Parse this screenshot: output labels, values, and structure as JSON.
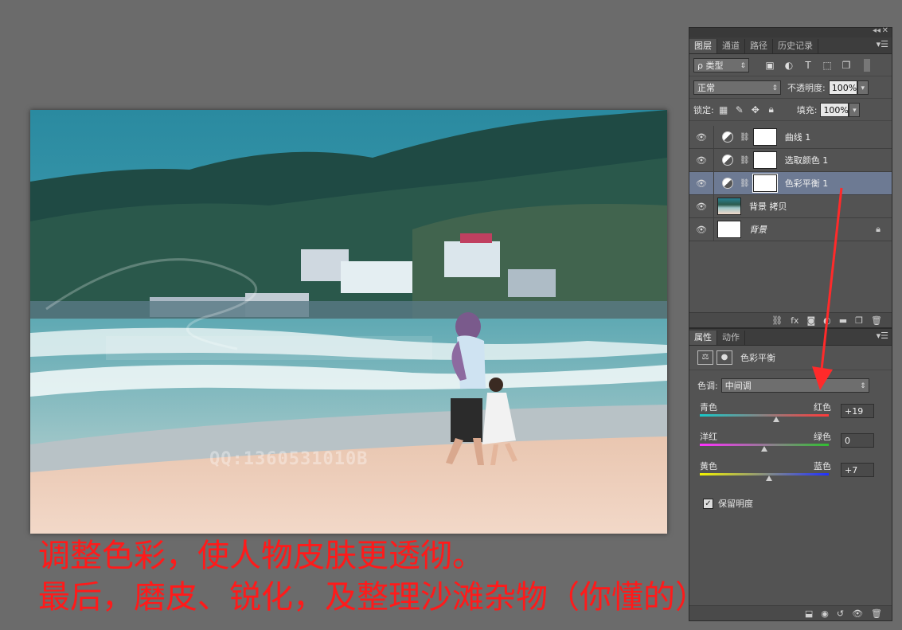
{
  "photo": {
    "watermark": "QQ:1360531010B"
  },
  "caption": {
    "line1": "调整色彩，使人物皮肤更透彻。",
    "line2": "最后，磨皮、锐化，及整理沙滩杂物（你懂的）"
  },
  "layers_panel": {
    "tabs": [
      "图层",
      "通道",
      "路径",
      "历史记录"
    ],
    "active_tab": 0,
    "filter_label": "ρ 类型",
    "blend_mode": "正常",
    "opacity_label": "不透明度:",
    "opacity_value": "100%",
    "lock_label": "锁定:",
    "fill_label": "填充:",
    "fill_value": "100%",
    "layers": [
      {
        "name": "曲线 1",
        "type": "adjustment",
        "selected": false
      },
      {
        "name": "选取颜色 1",
        "type": "adjustment",
        "selected": false
      },
      {
        "name": "色彩平衡 1",
        "type": "adjustment",
        "selected": true
      },
      {
        "name": "背景 拷贝",
        "type": "image",
        "selected": false
      },
      {
        "name": "背景",
        "type": "background",
        "selected": false
      }
    ]
  },
  "props_panel": {
    "tabs": [
      "属性",
      "动作"
    ],
    "title": "色彩平衡",
    "tone_label": "色调:",
    "tone_value": "中间调",
    "sliders": [
      {
        "left": "青色",
        "right": "红色",
        "value": "+19",
        "position": 0.59,
        "gradient": [
          "#18c9c9",
          "#ff3a3a"
        ]
      },
      {
        "left": "洋红",
        "right": "绿色",
        "value": "0",
        "position": 0.5,
        "gradient": [
          "#ff30ff",
          "#30c030"
        ]
      },
      {
        "left": "黄色",
        "right": "蓝色",
        "value": "+7",
        "position": 0.535,
        "gradient": [
          "#f3f300",
          "#2030ff"
        ]
      }
    ],
    "preserve_luminosity": "保留明度"
  },
  "colors": {
    "workspace": "#6b6b6b",
    "panel": "#535353",
    "selected_layer": "#6d7a93",
    "caption": "#ff1a1a",
    "arrow": "#ff2a2a"
  }
}
